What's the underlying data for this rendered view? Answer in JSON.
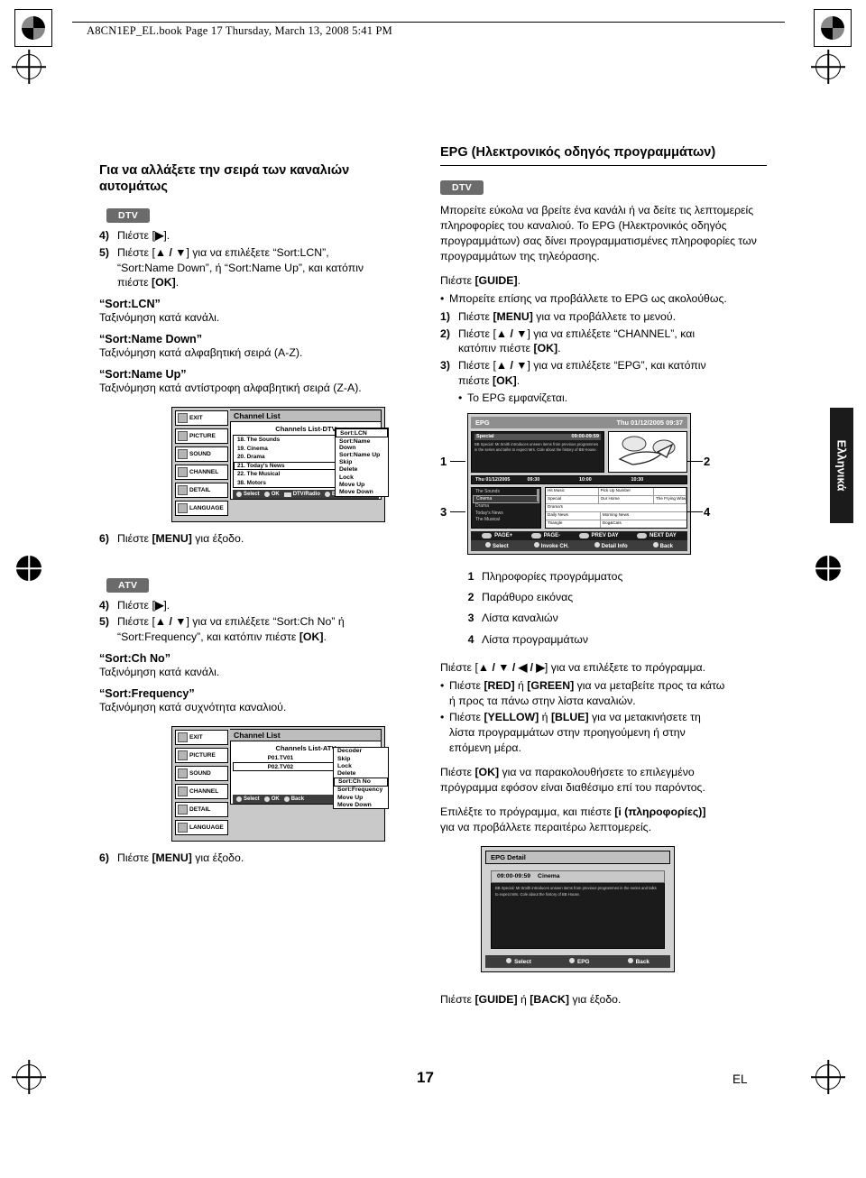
{
  "header": {
    "file_line": "A8CN1EP_EL.book  Page 17  Thursday, March 13, 2008  5:41 PM"
  },
  "footer": {
    "page_number": "17",
    "language_code": "EL"
  },
  "side_tab": {
    "label": "Ελληνικά"
  },
  "left_column": {
    "heading": "Για να αλλάξετε την σειρά των καναλιών αυτομάτως",
    "dtv": {
      "tag": "DTV",
      "steps": [
        {
          "num": "4)",
          "text": "Πιέστε [▶]."
        },
        {
          "num": "5)",
          "text": "Πιέστε [▲ / ▼] για να επιλέξετε “Sort:LCN”, “Sort:Name Down”, ή “Sort:Name Up”, και κατόπιν πιέστε [OK]."
        }
      ],
      "defs": [
        {
          "term": "“Sort:LCN”",
          "desc": "Ταξινόμηση κατά κανάλι."
        },
        {
          "term": "“Sort:Name Down”",
          "desc": "Ταξινόμηση κατά αλφαβητική σειρά (A-Z)."
        },
        {
          "term": "“Sort:Name Up”",
          "desc": "Ταξινόμηση κατά αντίστροφη αλφαβητική σειρά (Z-A)."
        }
      ],
      "exit_step": {
        "num": "6)",
        "text": "Πιέστε [MENU] για έξοδο."
      }
    },
    "atv": {
      "tag": "ATV",
      "steps": [
        {
          "num": "4)",
          "text": "Πιέστε [▶]."
        },
        {
          "num": "5)",
          "text": "Πιέστε [▲ / ▼] για να επιλέξετε “Sort:Ch No” ή “Sort:Frequency”, και κατόπιν πιέστε [OK]."
        }
      ],
      "defs": [
        {
          "term": "“Sort:Ch No”",
          "desc": "Ταξινόμηση κατά κανάλι."
        },
        {
          "term": "“Sort:Frequency”",
          "desc": "Ταξινόμηση κατά συχνότητα καναλιού."
        }
      ],
      "exit_step": {
        "num": "6)",
        "text": "Πιέστε [MENU] για έξοδο."
      }
    }
  },
  "osd_dtv": {
    "window_title": "Channel List",
    "sub_title": "Channels List-DTV",
    "side_menu": [
      "EXIT",
      "PICTURE",
      "SOUND",
      "CHANNEL",
      "DETAIL",
      "LANGUAGE"
    ],
    "active_side_item": "CHANNEL",
    "channels": [
      "18. The Sounds",
      "19. Cinema",
      "20. Drama",
      "21. Today's News",
      "22. The Musical",
      "38. Motors"
    ],
    "selected_channel": "21. Today's News",
    "popup_items": [
      "Sort:LCN",
      "Sort:Name Down",
      "Sort:Name Up",
      "Skip",
      "Delete",
      "Lock",
      "Move Up",
      "Move Down"
    ],
    "popup_highlight": "Sort:LCN",
    "footer_keys": [
      "Select",
      "OK",
      "DTV/Radio",
      "Back"
    ]
  },
  "osd_atv": {
    "window_title": "Channel List",
    "sub_title": "Channels List-ATV",
    "side_menu": [
      "EXIT",
      "PICTURE",
      "SOUND",
      "CHANNEL",
      "DETAIL",
      "LANGUAGE"
    ],
    "active_side_item": "CHANNEL",
    "channels": [
      "P01.TV01",
      "P02.TV02"
    ],
    "selected_channel": "P02.TV02",
    "popup_items": [
      "Decoder",
      "Skip",
      "Lock",
      "Delete",
      "Sort:Ch No",
      "Sort:Frequency",
      "Move Up",
      "Move Down"
    ],
    "popup_highlight": "Sort:Ch No",
    "footer_keys": [
      "Select",
      "OK",
      "Back"
    ]
  },
  "right_column": {
    "heading": "EPG (Ηλεκτρονικός οδηγός προγραμμάτων)",
    "tag": "DTV",
    "intro": "Μπορείτε εύκολα να βρείτε ένα κανάλι ή να δείτε τις λεπτομερείς πληροφορίες του καναλιού. Το EPG (Ηλεκτρονικός οδηγός προγραμμάτων) σας δίνει προγραμματισμένες πληροφορίες των προγραμμάτων της τηλεόρασης.",
    "guide_line": "Πιέστε [GUIDE].",
    "guide_bullet": "Μπορείτε επίσης να προβάλλετε το EPG ως ακολούθως.",
    "steps": [
      {
        "num": "1)",
        "text": "Πιέστε [MENU] για να προβάλλετε το μενού."
      },
      {
        "num": "2)",
        "text": "Πιέστε [▲ / ▼] για να επιλέξετε “CHANNEL”, και κατόπιν πιέστε [OK]."
      },
      {
        "num": "3)",
        "text": "Πιέστε [▲ / ▼] για να επιλέξετε “EPG”, και κατόπιν πιέστε [OK]."
      }
    ],
    "step3_bullet": "Το EPG εμφανίζεται.",
    "callouts": [
      "1",
      "2",
      "3",
      "4"
    ],
    "legend": [
      {
        "num": "1",
        "text": "Πληροφορίες προγράμματος"
      },
      {
        "num": "2",
        "text": "Παράθυρο εικόνας"
      },
      {
        "num": "3",
        "text": "Λίστα καναλιών"
      },
      {
        "num": "4",
        "text": "Λίστα προγραμμάτων"
      }
    ],
    "para_select": "Πιέστε [▲ / ▼ / ◀ / ▶] για να επιλέξετε το πρόγραμμα.",
    "bullets": [
      "Πιέστε [RED] ή [GREEN] για να μεταβείτε προς τα κάτω ή προς τα πάνω στην λίστα καναλιών.",
      "Πιέστε [YELLOW] ή [BLUE] για να μετακινήσετε τη λίστα προγραμμάτων στην προηγούμενη ή στην επόμενη μέρα."
    ],
    "para_ok": "Πιέστε [OK] για να παρακολουθήσετε το επιλεγμένο πρόγραμμα εφόσον είναι διαθέσιμο επί του παρόντος.",
    "para_info": "Επιλέξτε το πρόγραμμα, και πιέστε [i (πληροφορίες)] για να προβάλλετε περαιτέρω λεπτομερείς.",
    "para_exit": "Πιέστε [GUIDE] ή [BACK] για έξοδο."
  },
  "osd_epg": {
    "title": "EPG",
    "datetime": "Thu 01/12/2005  09:37",
    "info_title": "Special",
    "info_time": "09:00-09:59",
    "info_body": "BB Special: Mr.Smith introduces unseen items from previous programmes in the series and talks to expect Mrs. Cole about the history of BB House.",
    "timeline": [
      "Thu 01/12/2005",
      "09:30",
      "10:00",
      "10:30"
    ],
    "channels": [
      "The Sounds",
      "Cinema",
      "Drama",
      "Today's News",
      "The Musical"
    ],
    "selected_channel": "Cinema",
    "programme_grid": [
      [
        "Hit Music",
        "Pick Up Number",
        ""
      ],
      [
        "Special",
        "Our Home",
        "The Frying Witwen"
      ],
      [
        "Drama's",
        "",
        ""
      ],
      [
        "Daily News",
        "Morning News",
        ""
      ],
      [
        "Triangle",
        "Dog&Cats",
        ""
      ]
    ],
    "color_keys": [
      "PAGE+",
      "PAGE-",
      "PREV DAY",
      "NEXT DAY"
    ],
    "footer_keys": [
      "Select",
      "Invoke CH.",
      "Detail Info",
      "Back"
    ]
  },
  "osd_epg_detail": {
    "title": "EPG Detail",
    "prog_time": "09:00-09:59",
    "prog_name": "Cinema",
    "desc": "BB Special: Mr.Smith introduces unseen items from previous programmes in the series and talks to expect Mrs. Cole about the history of BB House.",
    "footer_keys": [
      "Select",
      "EPG",
      "Back"
    ]
  }
}
